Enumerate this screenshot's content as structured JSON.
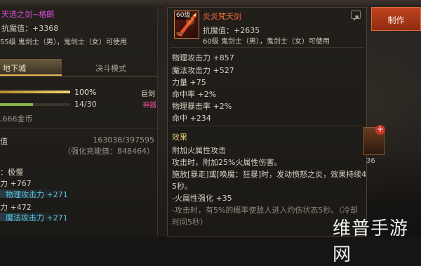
{
  "left_panel": {
    "title": "天选之剑~格朗",
    "resistance": "抗魔值：+3368",
    "requirement": "55级 鬼剑士（男），鬼剑士（女）可使用",
    "tabs": [
      "地下城",
      "决斗模式"
    ],
    "growth_bar": {
      "value": 1.0,
      "label": "100%"
    },
    "count_bar": {
      "value": 0.4667,
      "label": "14/30"
    },
    "class_labels": [
      "巨剑",
      "神器"
    ],
    "gold": ",666金币",
    "value_label": "值",
    "value_number": "163038/397595",
    "value_sub": "（强化充能值：848464）",
    "stats": [
      "：极慢",
      "力 +767",
      "物理攻击力 +271",
      "力 +472",
      "魔法攻击力 +271"
    ]
  },
  "item_tooltip": {
    "icon_level": "60级",
    "name": "炎炎梵天剑",
    "resistance": "抗魔值：+2635",
    "requirement": "60级 鬼剑士（男），鬼剑士（女）可使用",
    "stats": [
      "物理攻击力 +857",
      "魔法攻击力 +527",
      "力量 +75",
      "命中率 +2%",
      "物理暴击率 +2%",
      "命中 +234"
    ],
    "effect_title": "效果",
    "effect_lines": [
      "附加火属性攻击",
      "攻击时，附加25%火属性伤害。",
      "施放[暴走]或[唤魔：狂暴]时，发动愤怒之炎，效果持续4",
      "5秒。",
      "-火属性强化 +35",
      "-攻击时，有5%的概率使敌人进入灼伤状态5秒。（冷却",
      "时间5秒）"
    ]
  },
  "right_panel": {
    "craft_button": "制作",
    "slot_number": "36"
  },
  "watermark": "维普手游网"
}
